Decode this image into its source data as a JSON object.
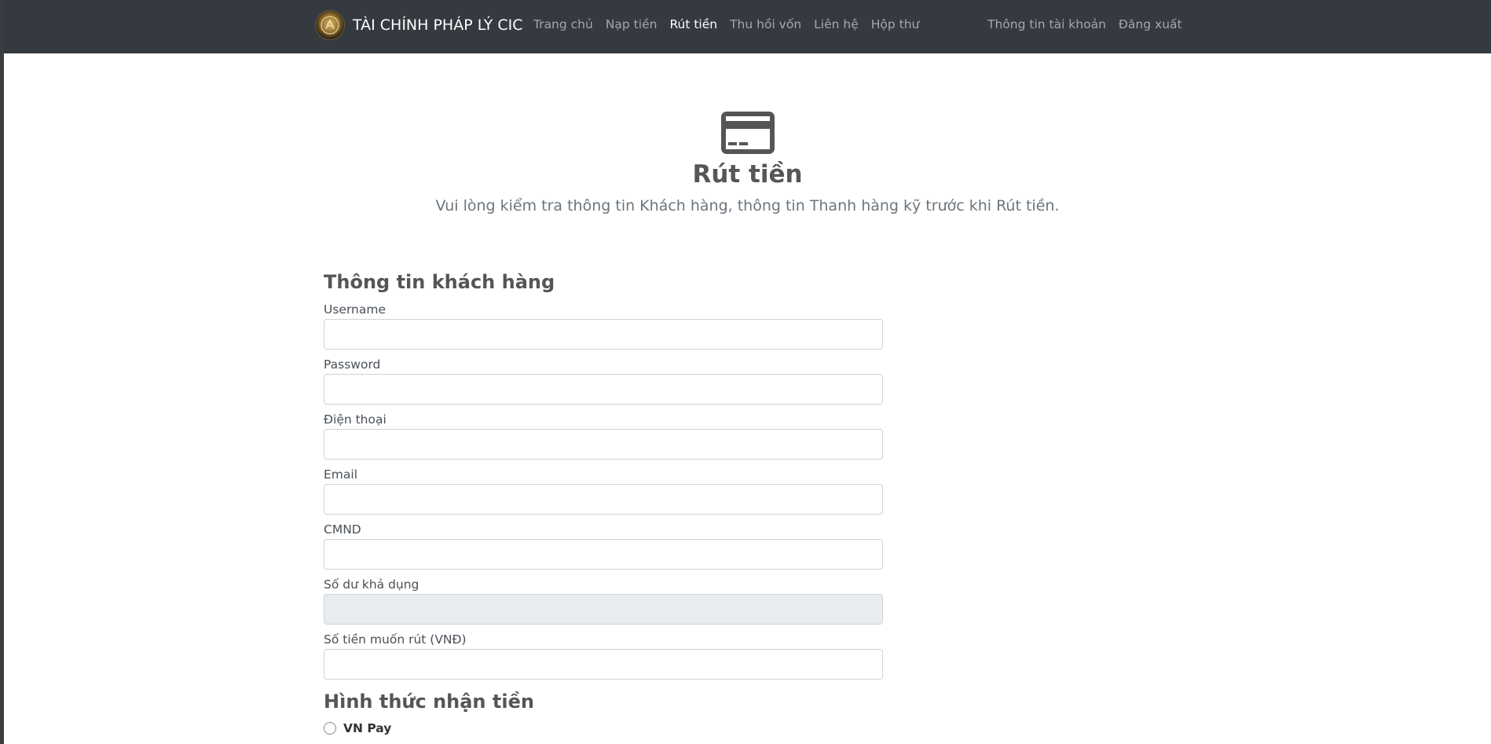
{
  "navbar": {
    "brand": "TÀI CHÍNH PHÁP LÝ CIC",
    "links": [
      {
        "label": "Trang chủ",
        "active": false
      },
      {
        "label": "Nạp tiền",
        "active": false
      },
      {
        "label": "Rút tiền",
        "active": true
      },
      {
        "label": "Thu hồi vốn",
        "active": false
      },
      {
        "label": "Liên hệ",
        "active": false
      },
      {
        "label": "Hộp thư",
        "active": false
      }
    ],
    "right_links": [
      {
        "label": "Thông tin tài khoản"
      },
      {
        "label": "Đăng xuất"
      }
    ]
  },
  "hero": {
    "icon": "credit-card-icon",
    "title": "Rút tiền",
    "subtitle": "Vui lòng kiểm tra thông tin Khách hàng, thông tin Thanh hàng kỹ trước khi Rút tiền."
  },
  "customer_section": {
    "title": "Thông tin khách hàng",
    "fields": [
      {
        "label": "Username",
        "value": "",
        "readonly": false
      },
      {
        "label": "Password",
        "value": "",
        "readonly": false
      },
      {
        "label": "Điện thoại",
        "value": "",
        "readonly": false
      },
      {
        "label": "Email",
        "value": "",
        "readonly": false
      },
      {
        "label": "CMND",
        "value": "",
        "readonly": false
      },
      {
        "label": "Số dư khả dụng",
        "value": "",
        "readonly": true
      },
      {
        "label": "Số tiền muốn rút (VNĐ)",
        "value": "",
        "readonly": false
      }
    ]
  },
  "payment_section": {
    "title": "Hình thức nhận tiền",
    "options": [
      {
        "label": "VN Pay",
        "checked": false
      }
    ]
  },
  "colors": {
    "navbar_bg": "#343a40",
    "nav_active": "#ffffff",
    "nav_inactive": "rgba(255,255,255,0.55)",
    "readonly_bg": "#e9ecef"
  }
}
